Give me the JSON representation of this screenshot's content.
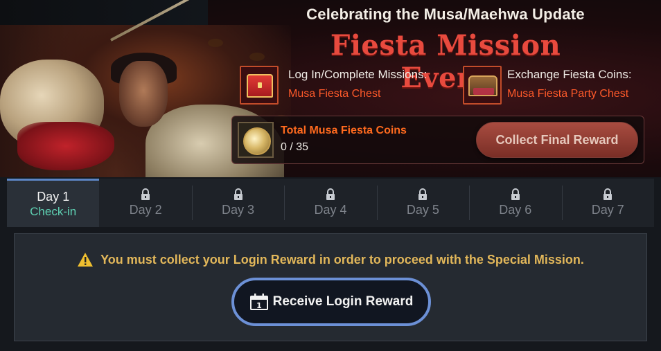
{
  "banner": {
    "subtitle": "Celebrating the Musa/Maehwa Update",
    "title": "Fiesta Mission Event",
    "rewards": [
      {
        "label": "Log In/Complete Missions:",
        "item": "Musa Fiesta Chest",
        "icon": "red-chest-icon"
      },
      {
        "label": "Exchange Fiesta Coins:",
        "item": "Musa Fiesta Party Chest",
        "icon": "party-chest-icon"
      }
    ],
    "coins": {
      "label": "Total Musa Fiesta Coins",
      "count": "0 / 35",
      "icon": "fiesta-coin-icon"
    },
    "final_reward_button": "Collect Final Reward"
  },
  "tabs": [
    {
      "title": "Day 1",
      "subtitle": "Check-in",
      "locked": false,
      "active": true
    },
    {
      "title": "Day 2",
      "locked": true
    },
    {
      "title": "Day 3",
      "locked": true
    },
    {
      "title": "Day 4",
      "locked": true
    },
    {
      "title": "Day 5",
      "locked": true
    },
    {
      "title": "Day 6",
      "locked": true
    },
    {
      "title": "Day 7",
      "locked": true
    }
  ],
  "content": {
    "warning": "You must collect your Login Reward in order to proceed with the Special Mission.",
    "receive_button": "Receive Login Reward",
    "calendar_day": "1"
  },
  "colors": {
    "accent_blue": "#6c90d6",
    "title_red": "#e84a3e",
    "reward_orange": "#ff5a2a",
    "warning_gold": "#e2b75a",
    "checkin_teal": "#5fd2b4"
  }
}
